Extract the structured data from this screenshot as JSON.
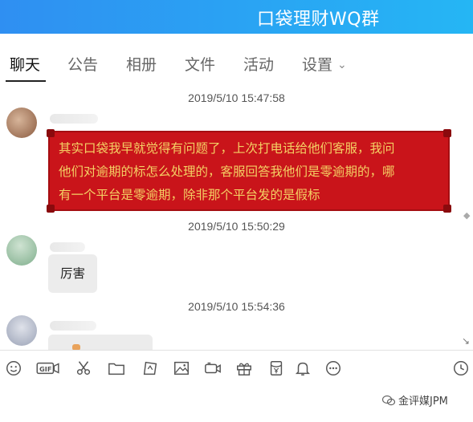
{
  "window": {
    "title": "口袋理财WQ群"
  },
  "tabs": [
    {
      "label": "聊天",
      "active": true
    },
    {
      "label": "公告"
    },
    {
      "label": "相册"
    },
    {
      "label": "文件"
    },
    {
      "label": "活动"
    },
    {
      "label": "设置"
    }
  ],
  "messages": [
    {
      "time": "2019/5/10 15:47:58",
      "text_lines": [
        "其实口袋我早就觉得有问题了，上次打电话给他们客服，我问",
        "他们对逾期的标怎么处理的，客服回答我他们是零逾期的，哪",
        "有一个平台是零逾期，除非那个平台发的是假标"
      ],
      "bubble_color": "#c9141a",
      "text_color": "#f4d064"
    },
    {
      "time": "2019/5/10 15:50:29",
      "text": "厉害"
    },
    {
      "time": "2019/5/10 15:54:36"
    }
  ],
  "toolbar": {
    "items": [
      "emoji-icon",
      "gif-icon",
      "scissors-icon",
      "folder-icon",
      "sticker-icon",
      "image-icon",
      "video-call-icon",
      "gift-icon",
      "red-packet-icon",
      "bell-icon",
      "more-icon",
      "history-icon"
    ]
  },
  "watermark": {
    "text": "金评媒JPM"
  },
  "colors": {
    "title_gradient_start": "#2f8ff2",
    "title_gradient_end": "#25b6f4"
  }
}
